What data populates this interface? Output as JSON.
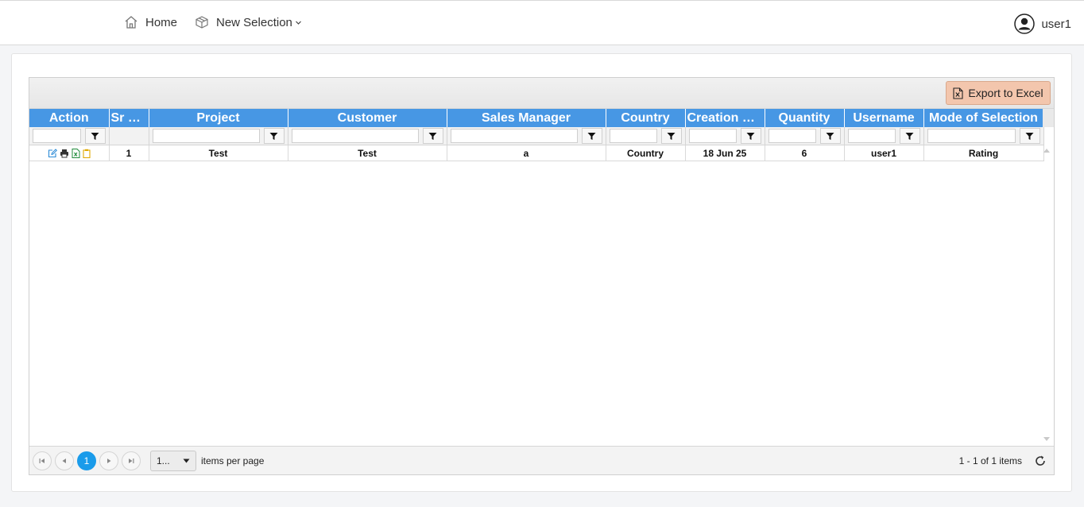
{
  "nav": {
    "home_label": "Home",
    "new_selection_label": "New Selection",
    "user_label": "user1"
  },
  "toolbar": {
    "export_label": "Export to Excel"
  },
  "grid": {
    "columns": [
      "Action",
      "Sr No.",
      "Project",
      "Customer",
      "Sales Manager",
      "Country",
      "Creation Da...",
      "Quantity",
      "Username",
      "Mode of Selection"
    ],
    "rows": [
      {
        "sr_no": "1",
        "project": "Test",
        "customer": "Test",
        "sales_manager": "a",
        "country": "Country",
        "creation_date": "18 Jun 25",
        "quantity": "6",
        "username": "user1",
        "mode_of_selection": "Rating"
      }
    ]
  },
  "pager": {
    "current_page": "1",
    "page_size": "1...",
    "items_per_page_label": "items per page",
    "info": "1 - 1 of 1 items"
  },
  "colors": {
    "header_bg": "#4797e4",
    "export_bg": "#f3c6ad",
    "active_page": "#1a9bea"
  }
}
